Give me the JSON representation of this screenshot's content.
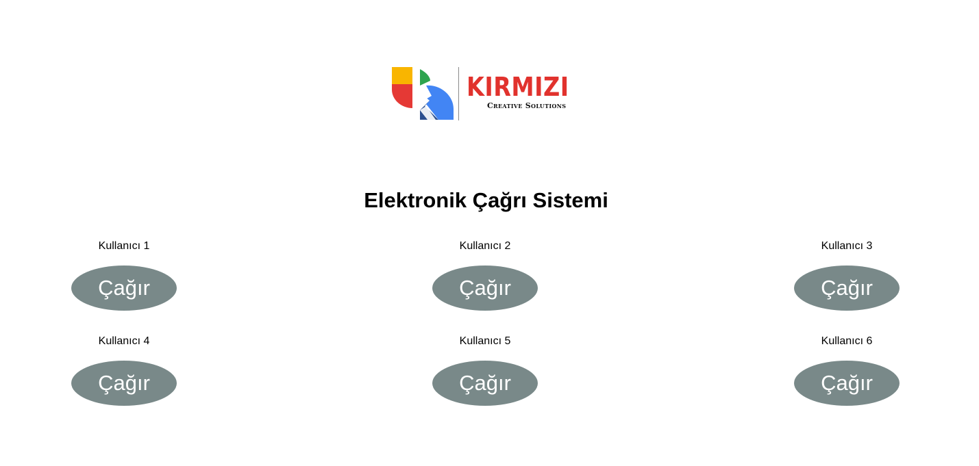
{
  "header": {
    "logo": {
      "name": "KIRMIZI",
      "tagline": "Creative Solutions",
      "colors": {
        "yellow": "#f9b500",
        "red": "#e53935",
        "green": "#2ea44f",
        "blue": "#4285f4",
        "navy": "#2b4f8f",
        "brand_text": "#e1322d"
      }
    }
  },
  "main": {
    "title": "Elektronik Çağrı Sistemi",
    "button_color": "#798989",
    "users": [
      {
        "label": "Kullanıcı 1",
        "button": "Çağır"
      },
      {
        "label": "Kullanıcı 2",
        "button": "Çağır"
      },
      {
        "label": "Kullanıcı 3",
        "button": "Çağır"
      },
      {
        "label": "Kullanıcı 4",
        "button": "Çağır"
      },
      {
        "label": "Kullanıcı 5",
        "button": "Çağır"
      },
      {
        "label": "Kullanıcı 6",
        "button": "Çağır"
      }
    ]
  }
}
